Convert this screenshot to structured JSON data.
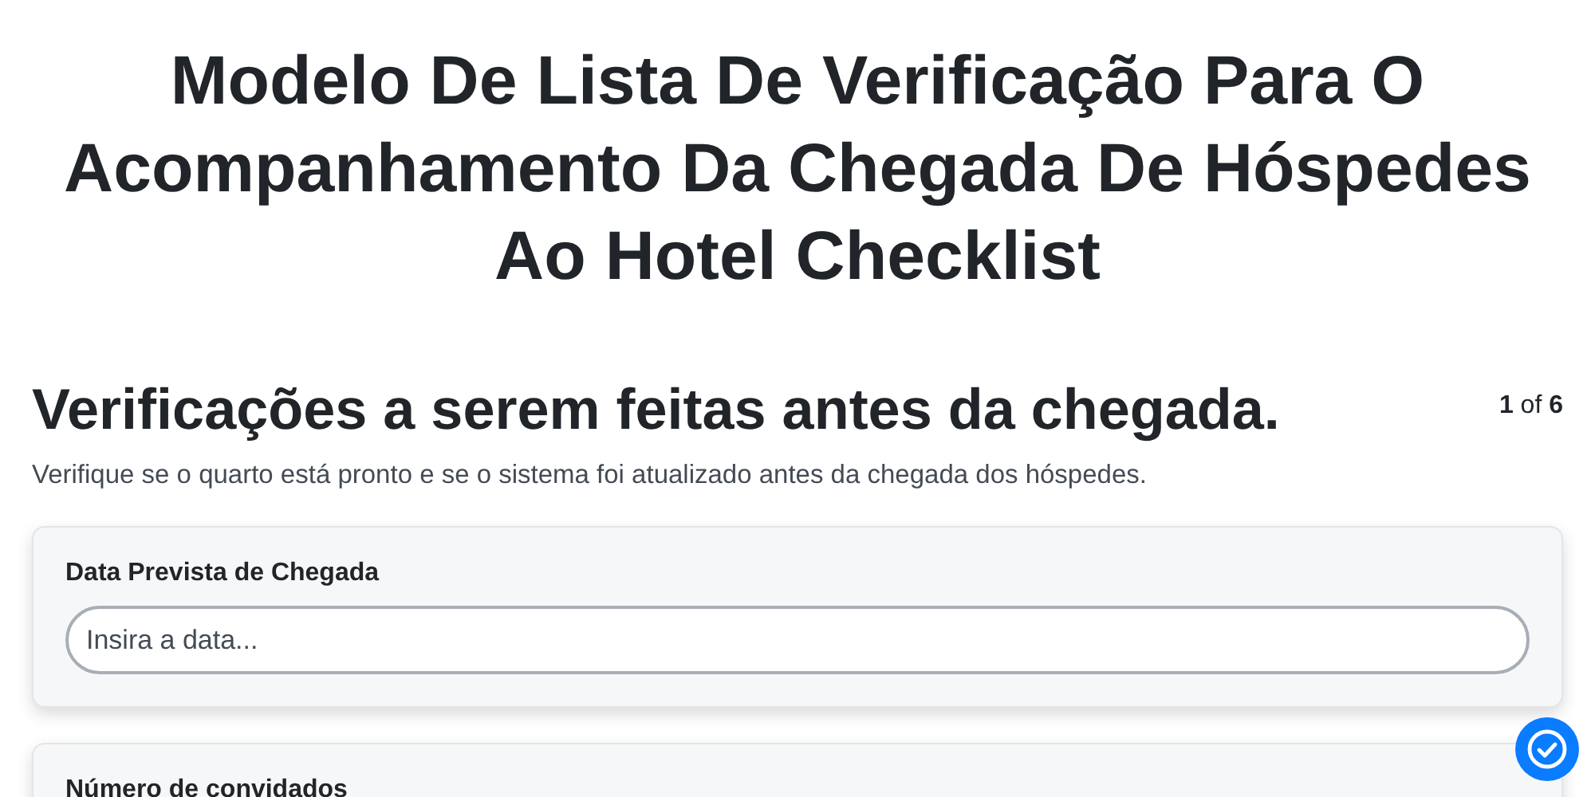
{
  "title": "Modelo De Lista De Verificação Para O Acompanhamento Da Chegada De Hóspedes Ao Hotel Checklist",
  "section": {
    "heading": "Verificações a serem feitas antes da chegada.",
    "pager": "**1** of **6**",
    "description": "Verifique se o quarto está pronto e se o sistema foi atualizado antes da chegada dos hóspedes."
  },
  "fields": [
    {
      "label": "Data Prevista de Chegada",
      "placeholder": "Insira a data..."
    },
    {
      "label": "Número de convidados"
    }
  ]
}
